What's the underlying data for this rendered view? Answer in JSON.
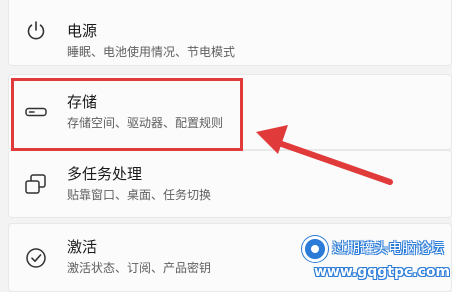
{
  "settings": {
    "items": [
      {
        "title": "电源",
        "desc": "睡眠、电池使用情况、节电模式",
        "icon": "power-icon"
      },
      {
        "title": "存储",
        "desc": "存储空间、驱动器、配置规则",
        "icon": "storage-drive-icon"
      },
      {
        "title": "多任务处理",
        "desc": "贴靠窗口、桌面、任务切换",
        "icon": "multitasking-icon"
      },
      {
        "title": "激活",
        "desc": "激活状态、订阅、产品密钥",
        "icon": "activation-check-icon"
      }
    ]
  },
  "annotation": {
    "highlight_color": "#e03a3a",
    "arrow_color": "#e03a3a"
  },
  "watermark": {
    "line1": "过期罐头电脑论坛",
    "line2": "www.gqgtpc.com",
    "color": "#2b7bd8"
  }
}
